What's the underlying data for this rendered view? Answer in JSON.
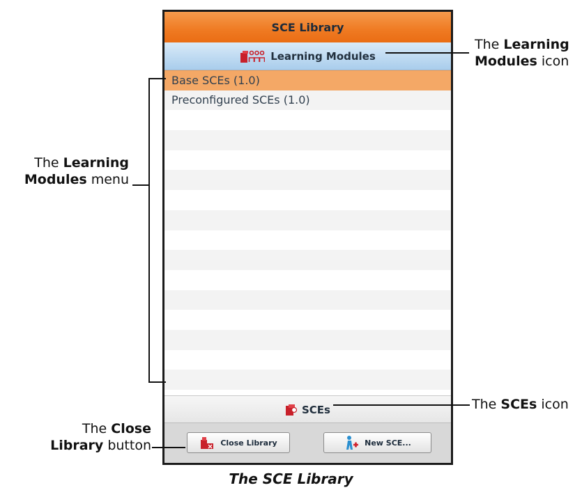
{
  "panel": {
    "title": "SCE Library",
    "section_label": "Learning Modules",
    "section_icon": "learning-modules-icon",
    "items": [
      {
        "label": "Base SCEs (1.0)",
        "selected": true
      },
      {
        "label": "Preconfigured SCEs (1.0)",
        "selected": false
      }
    ],
    "sces_label": "SCEs",
    "sces_icon": "sces-icon",
    "close_button": "Close Library",
    "new_button": "New SCE..."
  },
  "annotations": {
    "lm_icon": {
      "pre": "The",
      "bold1": "Learning",
      "bold2": "Modules",
      "post": "icon"
    },
    "lm_menu": {
      "pre": "The",
      "bold1": "Learning",
      "bold2": "Modules",
      "post": "menu"
    },
    "sces_icon": {
      "pre": "The",
      "bold": "SCEs",
      "post": "icon"
    },
    "close_btn": {
      "pre": "The",
      "bold1": "Close",
      "bold2": "Library",
      "post": "button"
    }
  },
  "caption": "The SCE Library",
  "colors": {
    "title_orange": "#ef7a22",
    "section_blue": "#a9cdec",
    "selected_row": "#f4a866"
  }
}
